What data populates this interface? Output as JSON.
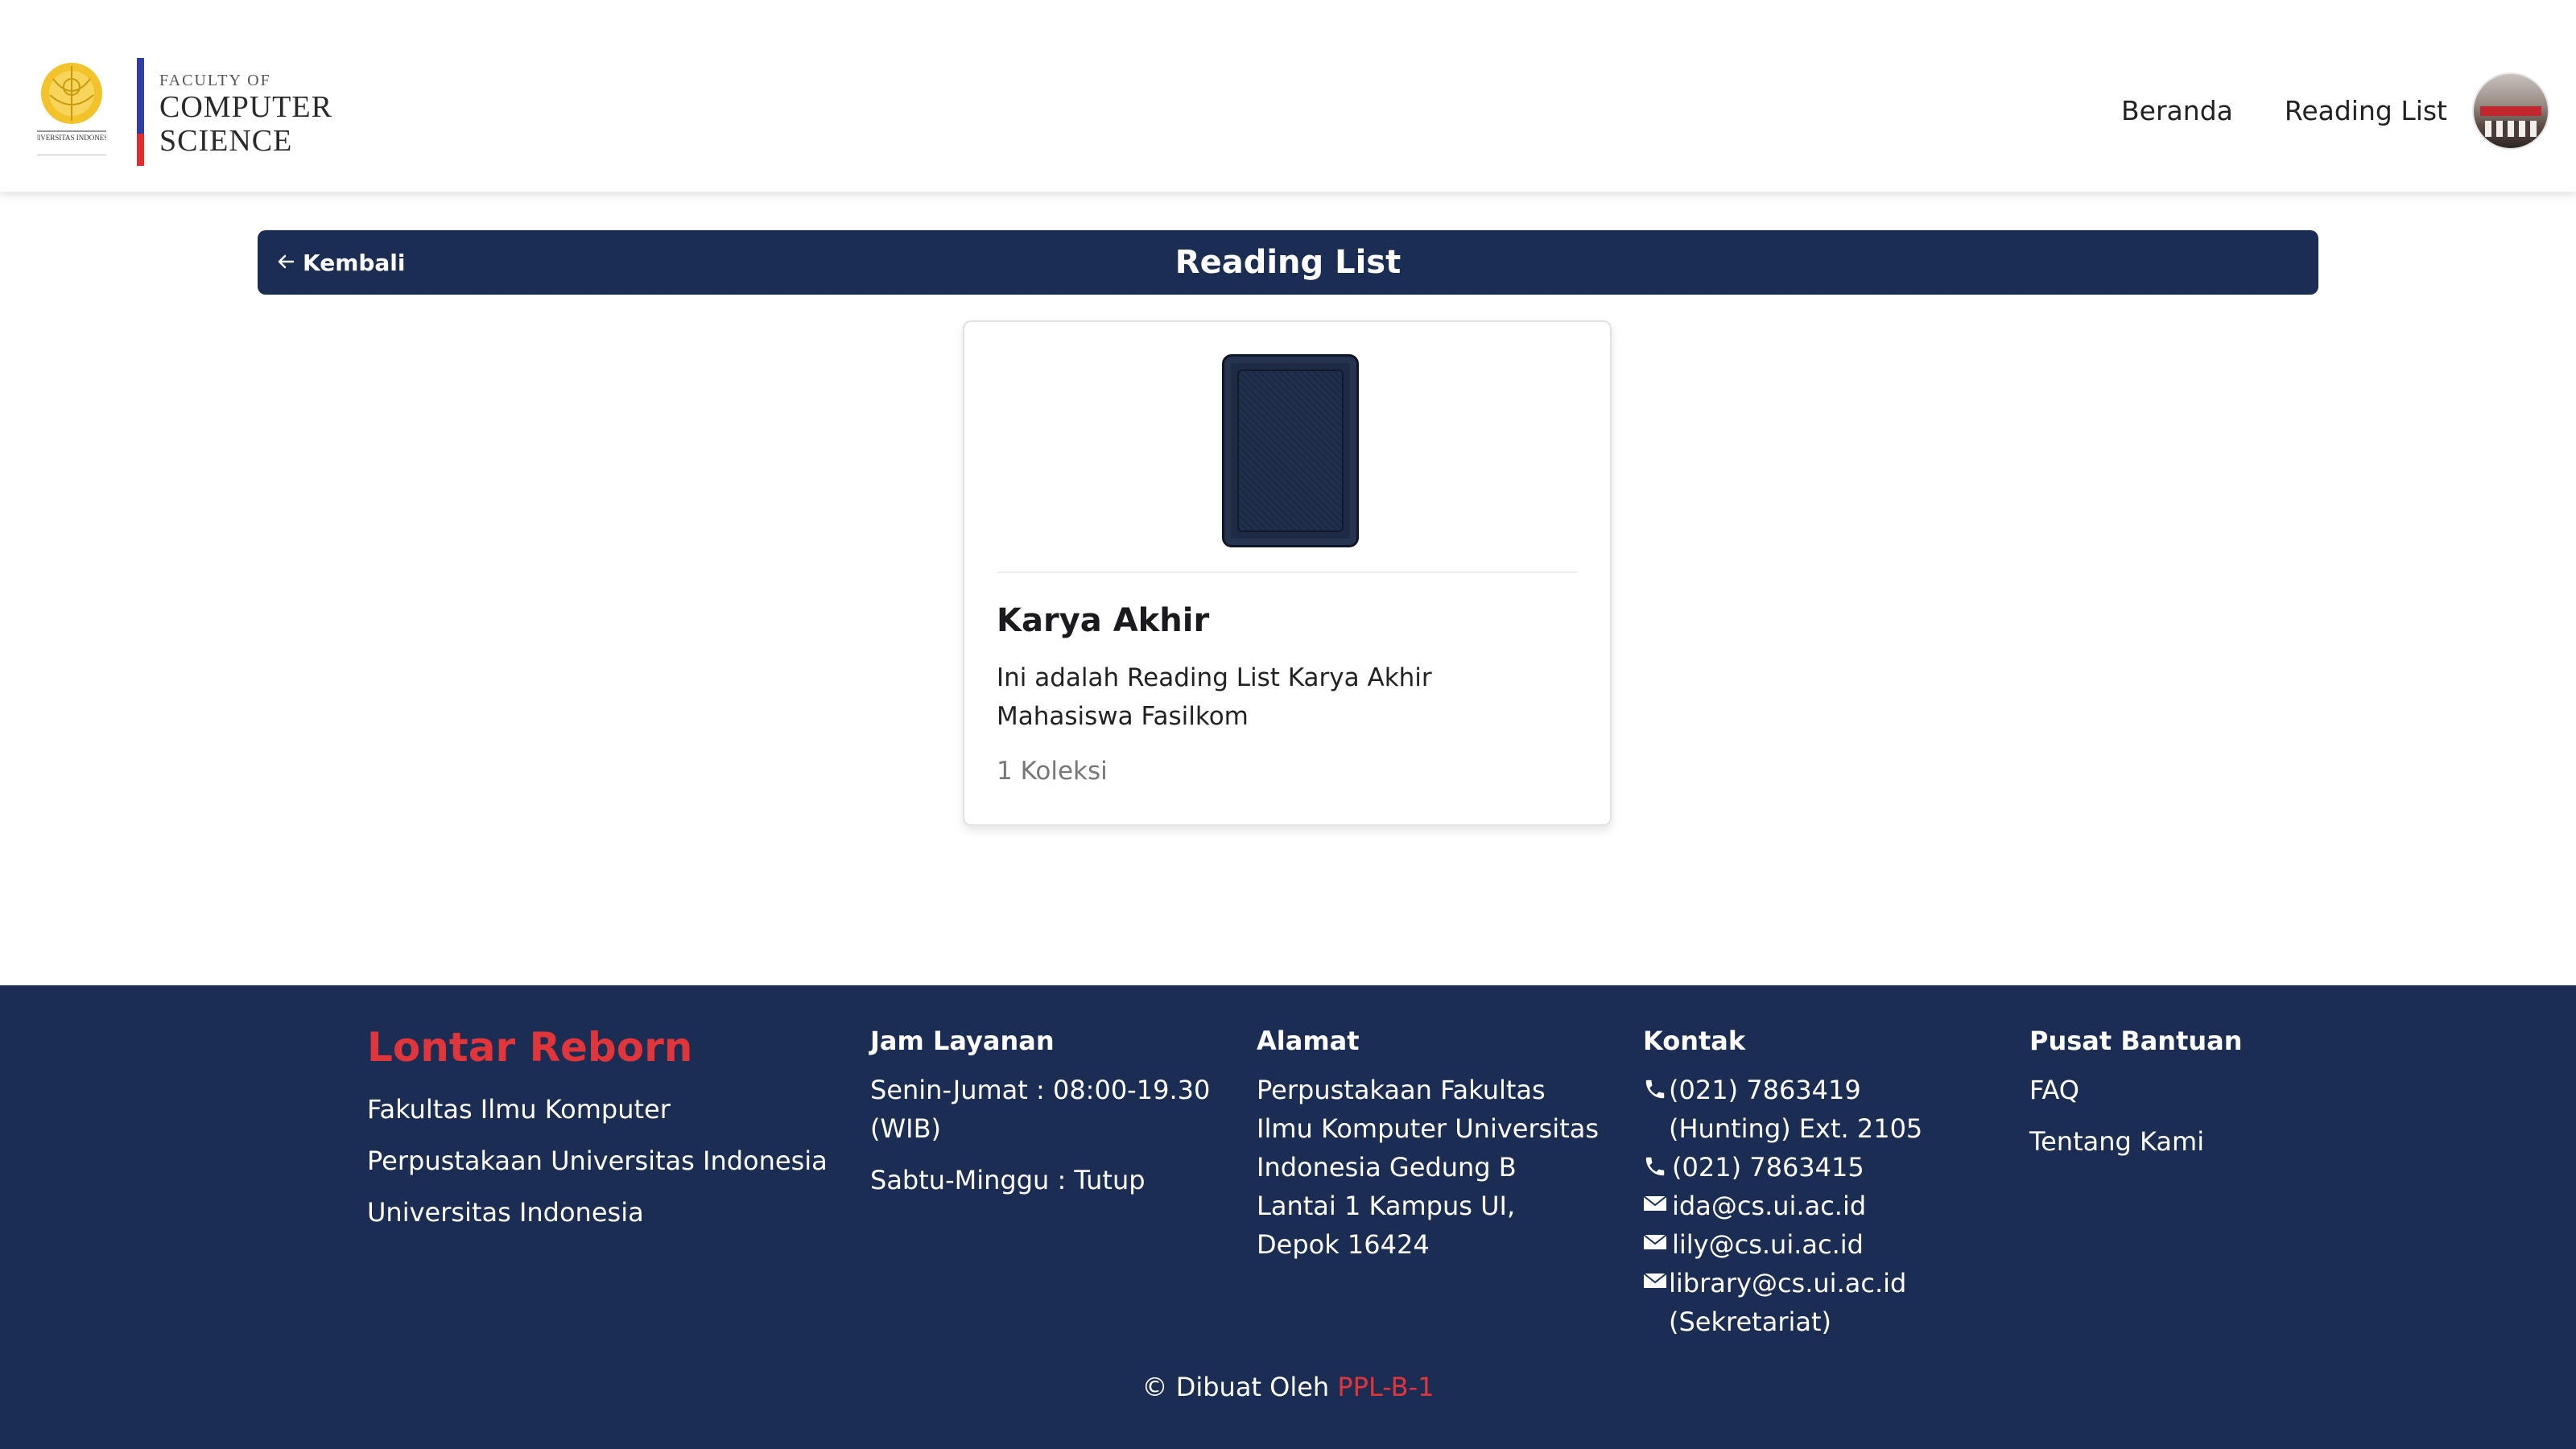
{
  "header": {
    "logo": {
      "name": "universitas-indonesia-logo",
      "text": "UNIVERSITAS INDONESIA"
    },
    "faculty": {
      "line1": "FACULTY OF",
      "line2": "COMPUTER",
      "line3": "SCIENCE"
    },
    "nav": [
      {
        "label": "Beranda"
      },
      {
        "label": "Reading List"
      }
    ],
    "avatar_icon": "user-avatar"
  },
  "title_bar": {
    "back_label": "Kembali",
    "back_icon": "arrow-left-icon",
    "title": "Reading List"
  },
  "reading_lists": [
    {
      "title": "Karya Akhir",
      "description": "Ini adalah Reading List Karya Akhir Mahasiswa Fasilkom",
      "count": "1 Koleksi"
    }
  ],
  "footer": {
    "brand": "Lontar Reborn",
    "brand_links": [
      "Fakultas Ilmu Komputer",
      "Perpustakaan Universitas Indonesia",
      "Universitas Indonesia"
    ],
    "hours": {
      "heading": "Jam Layanan",
      "weekday": "Senin-Jumat : 08:00-19.30 (WIB)",
      "weekend": "Sabtu-Minggu : Tutup"
    },
    "address": {
      "heading": "Alamat",
      "text": "Perpustakaan Fakultas Ilmu Komputer Universitas Indonesia Gedung B Lantai 1 Kampus UI, Depok 16424"
    },
    "contact": {
      "heading": "Kontak",
      "phone1": "(021) 7863419 (Hunting) Ext. 2105",
      "phone2": "(021) 7863415",
      "email1": "ida@cs.ui.ac.id",
      "email2": "lily@cs.ui.ac.id",
      "email3": "library@cs.ui.ac.id (Sekretariat)"
    },
    "help": {
      "heading": "Pusat Bantuan",
      "links": [
        "FAQ",
        "Tentang Kami"
      ]
    },
    "copyright_prefix": "© Dibuat Oleh",
    "copyright_team": "PPL-B-1"
  },
  "colors": {
    "navy": "#1c2d53",
    "accent_red": "#e0353b"
  }
}
